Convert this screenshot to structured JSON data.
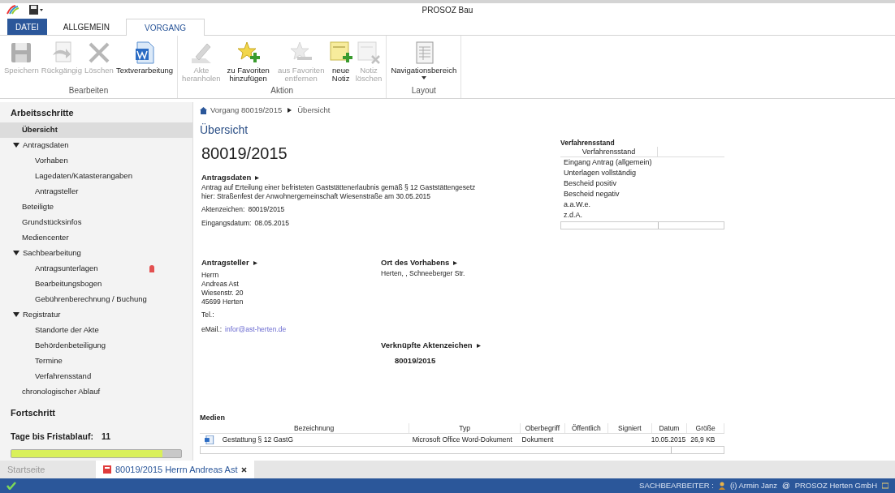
{
  "window": {
    "title": "PROSOZ Bau"
  },
  "ribbon_tabs": [
    {
      "label": "DATEI",
      "kind": "file",
      "selected": false
    },
    {
      "label": "ALLGEMEIN",
      "kind": "tab",
      "selected": false
    },
    {
      "label": "VORGANG",
      "kind": "tab",
      "selected": true
    }
  ],
  "ribbon_groups": [
    {
      "label": "Bearbeiten",
      "buttons": [
        {
          "label": "Speichern",
          "disabled": true
        },
        {
          "label": "Rückgängig",
          "disabled": true
        },
        {
          "label": "Löschen",
          "disabled": true
        },
        {
          "label": "Textverarbeitung",
          "disabled": false
        }
      ]
    },
    {
      "label": "Aktion",
      "buttons": [
        {
          "label": "Akte heranholen",
          "disabled": true
        },
        {
          "label": "zu Favoriten hinzufügen",
          "disabled": false
        },
        {
          "label": "aus Favoriten entfernen",
          "disabled": true
        },
        {
          "label": "neue Notiz",
          "disabled": false
        },
        {
          "label": "Notiz löschen",
          "disabled": true
        }
      ]
    },
    {
      "label": "Layout",
      "buttons": [
        {
          "label": "Navigationsbereich",
          "disabled": false,
          "dropdown": true
        }
      ]
    }
  ],
  "sidebar": {
    "title": "Arbeitsschritte",
    "items": [
      {
        "label": "Übersicht",
        "selected": true
      },
      {
        "label": "Antragsdaten",
        "selected": false,
        "expanded": true,
        "children": [
          {
            "label": "Vorhaben",
            "selected": false
          },
          {
            "label": "Lagedaten/Katasterangaben",
            "selected": false
          },
          {
            "label": "Antragsteller",
            "selected": false
          }
        ]
      },
      {
        "label": "Beteiligte",
        "selected": false
      },
      {
        "label": "Grundstücksinfos",
        "selected": false
      },
      {
        "label": "Mediencenter",
        "selected": false
      },
      {
        "label": "Sachbearbeitung",
        "selected": false,
        "expanded": true,
        "children": [
          {
            "label": "Antragsunterlagen",
            "selected": false,
            "alert": true
          },
          {
            "label": "Bearbeitungsbogen",
            "selected": false
          },
          {
            "label": "Gebührenberechnung / Buchung",
            "selected": false
          }
        ]
      },
      {
        "label": "Registratur",
        "selected": false,
        "expanded": true,
        "children": [
          {
            "label": "Standorte der Akte",
            "selected": false
          },
          {
            "label": "Behördenbeteiligung",
            "selected": false
          },
          {
            "label": "Termine",
            "selected": false
          },
          {
            "label": "Verfahrensstand",
            "selected": false
          }
        ]
      },
      {
        "label": "chronologischer Ablauf",
        "selected": false
      }
    ]
  },
  "progress": {
    "title": "Fortschritt",
    "label": "Tage bis Fristablauf:",
    "value": "11",
    "level": 0.89
  },
  "breadcrumb": [
    "Vorgang 80019/2015",
    "Übersicht"
  ],
  "page_title": "Übersicht",
  "case_number": "80019/2015",
  "antragsdaten": {
    "heading": "Antragsdaten",
    "lines": [
      "Antrag auf Erteilung einer befristeten Gaststättenerlaubnis gemäß § 12 Gaststättengesetz",
      "hier: Straßenfest der Anwohnergemeinschaft Wiesenstraße am 30.05.2015"
    ],
    "fields": [
      {
        "label": "Aktenzeichen:",
        "value": "80019/2015"
      },
      {
        "label": "Eingangsdatum:",
        "value": "08.05.2015"
      }
    ]
  },
  "verfahrensstand": {
    "title": "Verfahrensstand",
    "column": "Verfahrensstand",
    "rows": [
      "Eingang Antrag (allgemein)",
      "Unterlagen vollständig",
      "Bescheid positiv",
      "Bescheid negativ",
      "a.a.W.e.",
      "z.d.A."
    ]
  },
  "antragsteller": {
    "heading": "Antragsteller",
    "address": [
      "Herrn",
      "Andreas Ast",
      "Wiesenstr. 20",
      "45699 Herten"
    ],
    "phone_label": "Tel.:",
    "email_label": "eMail.:",
    "email": "infor@ast-herten.de"
  },
  "ort": {
    "heading": "Ort des Vorhabens",
    "text": "Herten, , Schneeberger Str."
  },
  "verknuepfte": {
    "heading": "Verknüpfte Aktenzeichen",
    "items": [
      "80019/2015"
    ]
  },
  "medien": {
    "title": "Medien",
    "columns": [
      "Bezeichnung",
      "Typ",
      "Oberbegriff",
      "Öffentlich",
      "Signiert",
      "Datum",
      "Größe"
    ],
    "rows": [
      [
        "Gestattung § 12 GastG",
        "Microsoft Office Word-Dokument",
        "Dokument",
        "",
        "",
        "10.05.2015",
        "26,9 KB"
      ]
    ]
  },
  "doc_tabs": [
    {
      "label": "Startseite",
      "selected": false
    },
    {
      "label": "80019/2015 Herrn Andreas Ast",
      "selected": true,
      "closable": true
    }
  ],
  "status_bar": {
    "role": "SACHBEARBEITER :",
    "user": "(i) Armin Janz",
    "at": "@",
    "company": "PROSOZ Herten GmbH"
  }
}
